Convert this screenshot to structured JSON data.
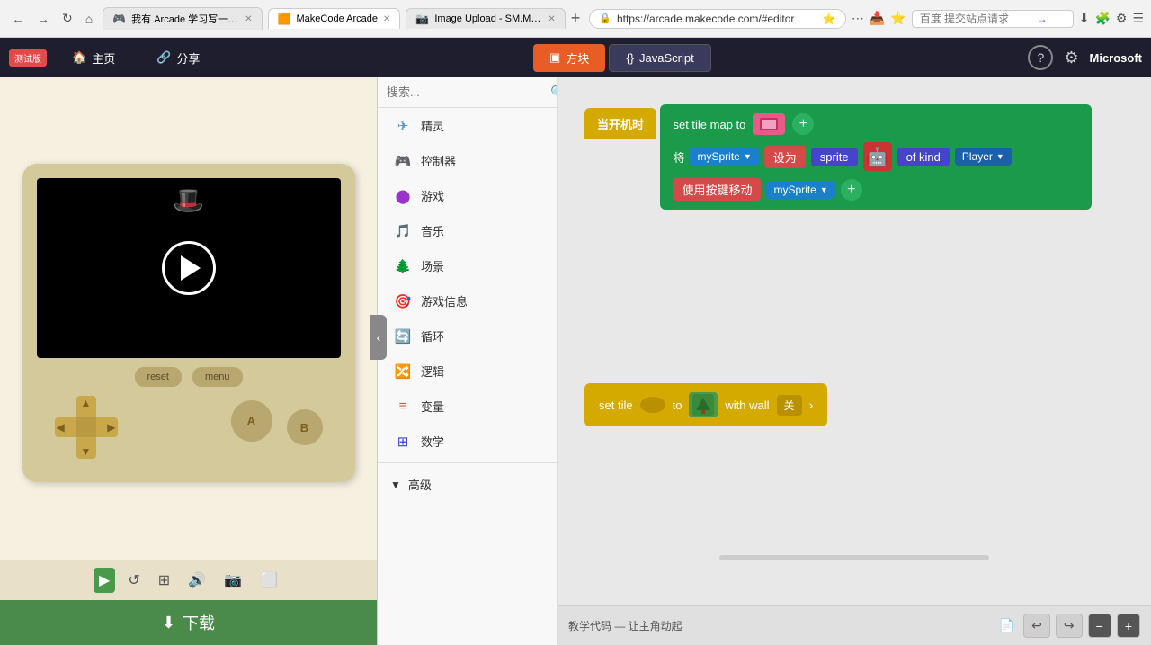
{
  "browser": {
    "tabs": [
      {
        "label": "我有 Arcade 学习写一款 RPG 游戏...",
        "active": false,
        "favicon": "🎮"
      },
      {
        "label": "MakeCode Arcade",
        "active": true,
        "favicon": "🟧"
      },
      {
        "label": "Image Upload - SM.MS - Simp...",
        "active": false,
        "favicon": "📷"
      }
    ],
    "url": "https://arcade.makecode.com/#editor",
    "search_placeholder": "百度 提交站点请求"
  },
  "appbar": {
    "badge": "测试版",
    "home_label": "主页",
    "share_label": "分享",
    "tab_blocks": "方块",
    "tab_js": "JavaScript",
    "help_icon": "?",
    "settings_icon": "⚙",
    "ms_logo": "Microsoft"
  },
  "sidebar": {
    "search_placeholder": "搜索...",
    "items": [
      {
        "label": "精灵",
        "icon": "✈",
        "color": "#5599cc"
      },
      {
        "label": "控制器",
        "icon": "🎮",
        "color": "#cc5522"
      },
      {
        "label": "游戏",
        "icon": "⬤",
        "color": "#9933cc"
      },
      {
        "label": "音乐",
        "icon": "🎵",
        "color": "#44aacc"
      },
      {
        "label": "场景",
        "icon": "🌲",
        "color": "#44aa44"
      },
      {
        "label": "游戏信息",
        "icon": "🎯",
        "color": "#cc6644"
      },
      {
        "label": "循环",
        "icon": "🔄",
        "color": "#cc4444"
      },
      {
        "label": "逻辑",
        "icon": "🔀",
        "color": "#cc8844"
      },
      {
        "label": "变量",
        "icon": "≡",
        "color": "#ee4444"
      },
      {
        "label": "数学",
        "icon": "⊞",
        "color": "#3344cc"
      },
      {
        "label": "高级",
        "icon": "▼",
        "color": "#555555"
      }
    ]
  },
  "code": {
    "on_start_label": "当开机时",
    "set_tile_map_text": "set tile map to",
    "var_label": "将",
    "mySprite_label": "mySprite",
    "set_label": "设为",
    "sprite_label": "sprite",
    "of_kind_label": "of kind",
    "player_label": "Player",
    "move_label": "使用按键移动",
    "mySprite2_label": "mySprite",
    "set_tile_text": "set tile",
    "to_text": "to",
    "with_wall_text": "with wall",
    "close_text": "关"
  },
  "simulator": {
    "reset_btn": "reset",
    "menu_btn": "menu",
    "download_label": "下载",
    "toolbar_btns": [
      "▶",
      "↺",
      "⊞",
      "🔊",
      "📷",
      "⬜"
    ]
  },
  "bottom_bar": {
    "tutorial_text": "教学代码 — 让主角动起",
    "undo_icon": "↩",
    "redo_icon": "↪",
    "minus_icon": "−",
    "plus_icon": "+"
  }
}
